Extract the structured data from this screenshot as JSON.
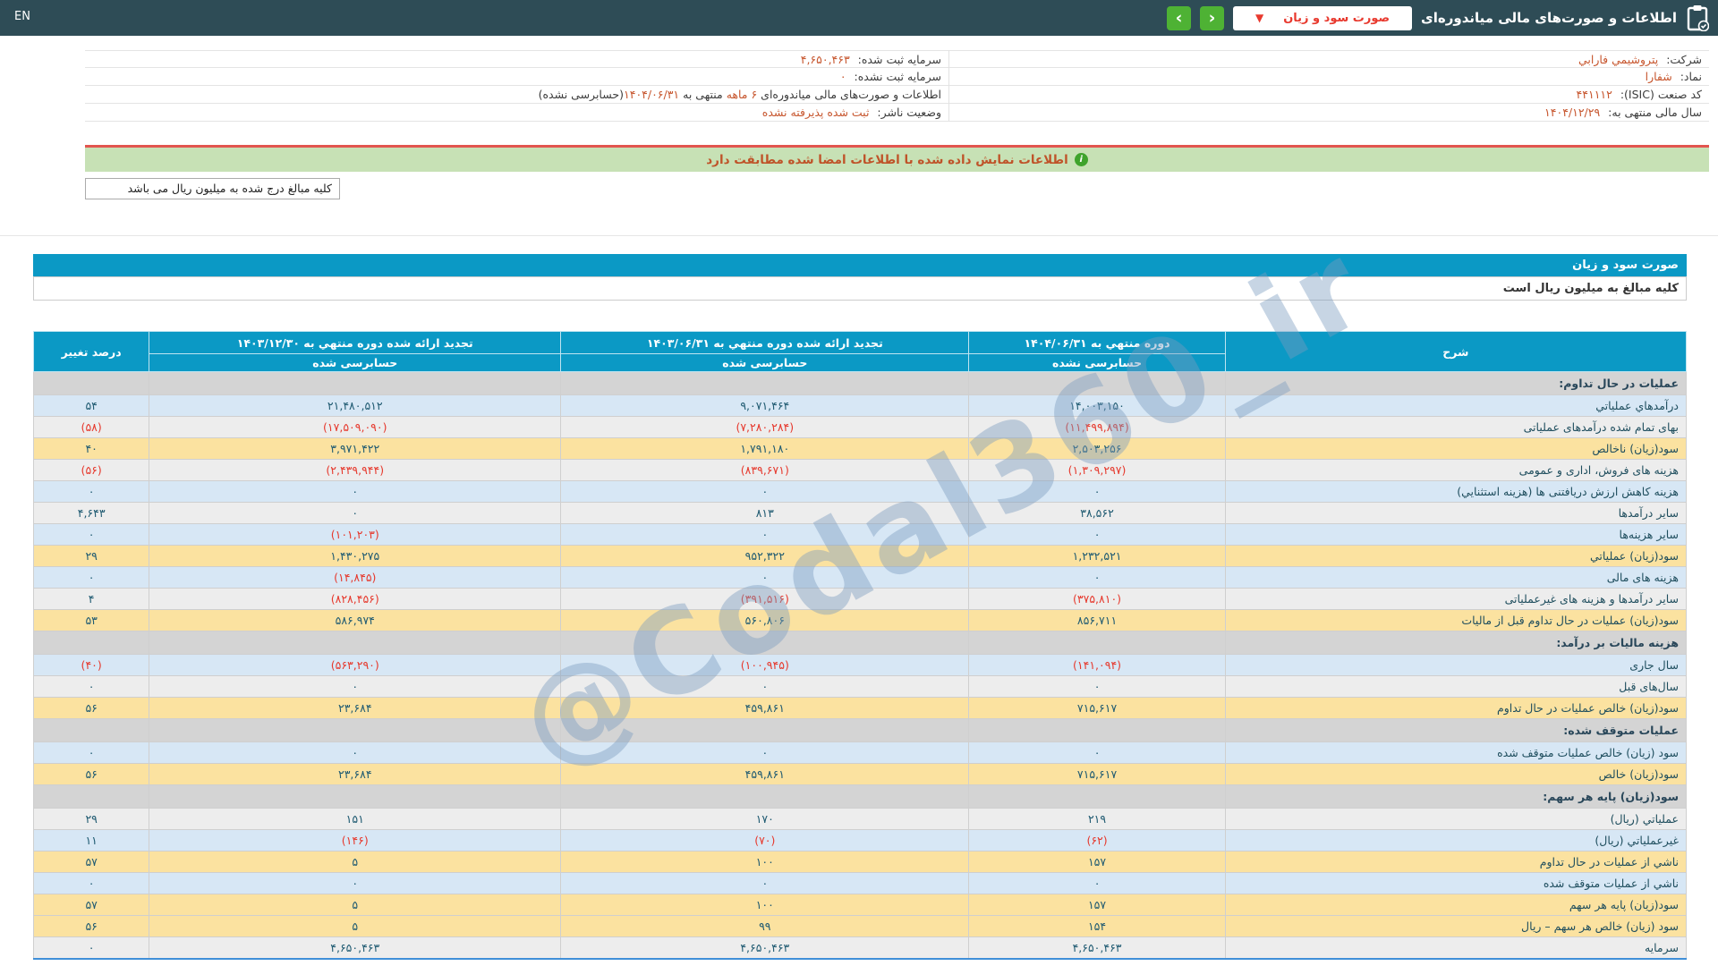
{
  "topbar": {
    "en_label": "EN",
    "title": "اطلاعات و صورت‌های مالی میاندوره‌ای",
    "dropdown_value": "صورت سود و زیان",
    "dropdown_chevron": "▼",
    "nav_back": "‹",
    "nav_forward": "›",
    "colors": {
      "bar": "#2e4c56",
      "button_green": "#4eb234",
      "dropdown_text": "#e8392e"
    }
  },
  "company_info": {
    "right_column": [
      {
        "label": "شرکت:",
        "value": "پتروشيمي فارابي"
      },
      {
        "label": "نماد:",
        "value": "شفارا"
      },
      {
        "label": "کد صنعت (ISIC):",
        "value": "۴۴۱۱۱۲"
      },
      {
        "label": "سال مالی منتهی به:",
        "value": "۱۴۰۴/۱۲/۲۹"
      }
    ],
    "left_column": [
      {
        "label": "سرمایه ثبت شده:",
        "value": "۴,۶۵۰,۴۶۳"
      },
      {
        "label": "سرمایه ثبت نشده:",
        "value": "۰"
      },
      {
        "parts": {
          "p1": "اطلاعات و صورت‌های مالی میاندوره‌ای ",
          "hl1": "۶ ماهه",
          "p2": " منتهی به ",
          "hl2": "۱۴۰۴/۰۶/۳۱",
          "p3": "(حسابرسی نشده)"
        }
      },
      {
        "label": "وضعیت ناشر:",
        "value": "ثبت شده پذیرفته نشده"
      }
    ]
  },
  "banner": {
    "text": "اطلاعات نمایش داده شده با اطلاعات امضا شده مطابقت دارد",
    "icon": "i"
  },
  "million_note": "کلیه مبالغ درج شده به میلیون ریال می باشد",
  "statement": {
    "title": "صورت سود و زیان",
    "subtitle": "کلیه مبالغ به میلیون ریال است"
  },
  "table": {
    "headers": {
      "desc": "شرح",
      "period_current": "دوره منتهي به ۱۴۰۴/۰۶/۳۱",
      "period_current_sub": "حسابرسی نشده",
      "period_prev": "تجدید ارائه شده دوره منتهي به ۱۴۰۳/۰۶/۳۱",
      "period_prev_sub": "حسابرسی شده",
      "period_year": "تجدید ارائه شده دوره منتهي به ۱۴۰۳/۱۲/۳۰",
      "period_year_sub": "حسابرسی شده",
      "change": "درصد تغییر"
    },
    "rows": [
      {
        "type": "section",
        "label": "عملیات در حال تداوم:"
      },
      {
        "style": "blue",
        "label": "درآمدهاي عملیاتي",
        "v1": "۱۴,۰۰۳,۱۵۰",
        "v2": "۹,۰۷۱,۴۶۴",
        "v3": "۲۱,۴۸۰,۵۱۲",
        "chg": "۵۴"
      },
      {
        "style": "gray",
        "label": "بهای تمام شده درآمدهای عملیاتی",
        "v1": "(۱۱,۴۹۹,۸۹۴)",
        "v2": "(۷,۲۸۰,۲۸۴)",
        "v3": "(۱۷,۵۰۹,۰۹۰)",
        "chg": "(۵۸)"
      },
      {
        "style": "yellow",
        "label": "سود(زیان) ناخالص",
        "v1": "۲,۵۰۳,۲۵۶",
        "v2": "۱,۷۹۱,۱۸۰",
        "v3": "۳,۹۷۱,۴۲۲",
        "chg": "۴۰"
      },
      {
        "style": "gray",
        "label": "هزینه های فروش، اداری و عمومی",
        "v1": "(۱,۳۰۹,۲۹۷)",
        "v2": "(۸۳۹,۶۷۱)",
        "v3": "(۲,۴۳۹,۹۴۴)",
        "chg": "(۵۶)"
      },
      {
        "style": "blue",
        "label": "هزینه کاهش ارزش دریافتنی ها (هزینه استثنایي)",
        "v1": "۰",
        "v2": "۰",
        "v3": "۰",
        "chg": "۰"
      },
      {
        "style": "gray",
        "label": "سایر درآمدها",
        "v1": "۳۸,۵۶۲",
        "v2": "۸۱۳",
        "v3": "۰",
        "chg": "۴,۶۴۳"
      },
      {
        "style": "blue",
        "label": "سایر هزینه‌ها",
        "v1": "۰",
        "v2": "۰",
        "v3": "(۱۰۱,۲۰۳)",
        "chg": "۰"
      },
      {
        "style": "yellow",
        "label": "سود(زیان) عملیاتي",
        "v1": "۱,۲۳۲,۵۲۱",
        "v2": "۹۵۲,۳۲۲",
        "v3": "۱,۴۳۰,۲۷۵",
        "chg": "۲۹"
      },
      {
        "style": "blue",
        "label": "هزینه های مالی",
        "v1": "۰",
        "v2": "۰",
        "v3": "(۱۴,۸۴۵)",
        "chg": "۰"
      },
      {
        "style": "gray",
        "label": "سایر درآمدها و هزینه های غیرعملیاتی",
        "v1": "(۳۷۵,۸۱۰)",
        "v2": "(۳۹۱,۵۱۶)",
        "v3": "(۸۲۸,۴۵۶)",
        "chg": "۴"
      },
      {
        "style": "yellow",
        "label": "سود(زیان) عملیات در حال تداوم قبل از مالیات",
        "v1": "۸۵۶,۷۱۱",
        "v2": "۵۶۰,۸۰۶",
        "v3": "۵۸۶,۹۷۴",
        "chg": "۵۳"
      },
      {
        "type": "section",
        "label": "هزینه مالیات بر درآمد:"
      },
      {
        "style": "blue",
        "label": "سال جاری",
        "v1": "(۱۴۱,۰۹۴)",
        "v2": "(۱۰۰,۹۴۵)",
        "v3": "(۵۶۳,۲۹۰)",
        "chg": "(۴۰)"
      },
      {
        "style": "gray",
        "label": "سال‌های قبل",
        "v1": "۰",
        "v2": "۰",
        "v3": "۰",
        "chg": "۰"
      },
      {
        "style": "yellow",
        "label": "سود(زیان) خالص عملیات در حال تداوم",
        "v1": "۷۱۵,۶۱۷",
        "v2": "۴۵۹,۸۶۱",
        "v3": "۲۳,۶۸۴",
        "chg": "۵۶"
      },
      {
        "type": "section",
        "label": "عملیات متوقف شده:"
      },
      {
        "style": "blue",
        "label": "سود (زیان) خالص عملیات متوقف شده",
        "v1": "۰",
        "v2": "۰",
        "v3": "۰",
        "chg": "۰"
      },
      {
        "style": "yellow",
        "label": "سود(زیان) خالص",
        "v1": "۷۱۵,۶۱۷",
        "v2": "۴۵۹,۸۶۱",
        "v3": "۲۳,۶۸۴",
        "chg": "۵۶"
      },
      {
        "type": "section",
        "label": "سود(زیان) پایه هر سهم:"
      },
      {
        "style": "gray",
        "label": "عملیاتي (ریال)",
        "v1": "۲۱۹",
        "v2": "۱۷۰",
        "v3": "۱۵۱",
        "chg": "۲۹"
      },
      {
        "style": "blue",
        "label": "غیرعملیاتي (ریال)",
        "v1": "(۶۲)",
        "v2": "(۷۰)",
        "v3": "(۱۴۶)",
        "chg": "۱۱"
      },
      {
        "style": "yellow",
        "label": "ناشي از عملیات در حال تداوم",
        "v1": "۱۵۷",
        "v2": "۱۰۰",
        "v3": "۵",
        "chg": "۵۷"
      },
      {
        "style": "blue",
        "label": "ناشي از عملیات متوقف شده",
        "v1": "۰",
        "v2": "۰",
        "v3": "۰",
        "chg": "۰"
      },
      {
        "style": "yellow",
        "label": "سود(زیان) پایه هر سهم",
        "v1": "۱۵۷",
        "v2": "۱۰۰",
        "v3": "۵",
        "chg": "۵۷"
      },
      {
        "style": "yellow",
        "label": "سود (زیان) خالص هر سهم – ریال",
        "v1": "۱۵۴",
        "v2": "۹۹",
        "v3": "۵",
        "chg": "۵۶"
      },
      {
        "style": "gray",
        "label": "سرمایه",
        "v1": "۴,۶۵۰,۴۶۳",
        "v2": "۴,۶۵۰,۴۶۳",
        "v3": "۴,۶۵۰,۴۶۳",
        "chg": "۰"
      }
    ]
  },
  "watermark": "@Codal360_ir"
}
